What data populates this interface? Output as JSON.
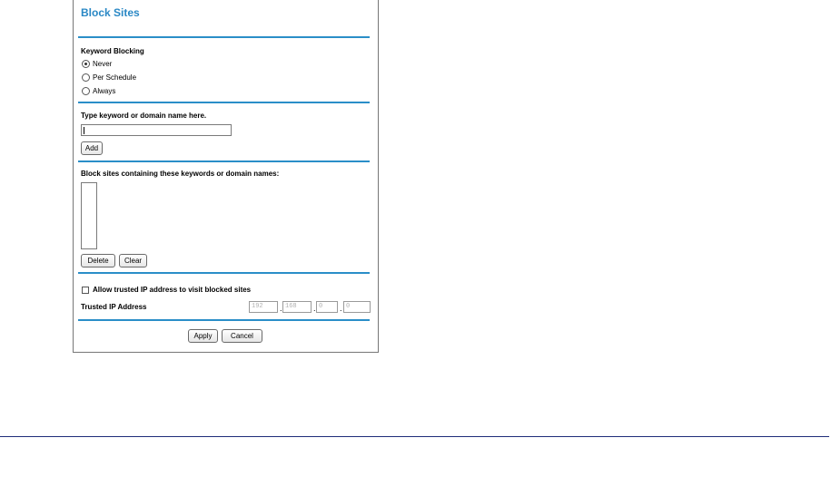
{
  "block_sites": {
    "title": "Block Sites",
    "keyword_blocking": {
      "label": "Keyword Blocking",
      "options": [
        "Never",
        "Per Schedule",
        "Always"
      ],
      "selected": "Never"
    },
    "add_keyword": {
      "label": "Type keyword or domain name here.",
      "input_value": "",
      "add_label": "Add"
    },
    "blocked_list": {
      "label": "Block sites containing these keywords or domain names:",
      "items": [],
      "delete_label": "Delete",
      "clear_label": "Clear"
    },
    "trusted": {
      "allow_label": "Allow trusted IP address to visit blocked sites",
      "allow_checked": false,
      "ip_label": "Trusted IP Address",
      "ip_octets": [
        "192",
        "168",
        "0",
        "0"
      ]
    },
    "actions": {
      "apply_label": "Apply",
      "cancel_label": "Cancel"
    }
  },
  "colors": {
    "title": "#2a88c5",
    "rule": "#2a8ec8",
    "bottom_line": "#1f2c7a"
  }
}
